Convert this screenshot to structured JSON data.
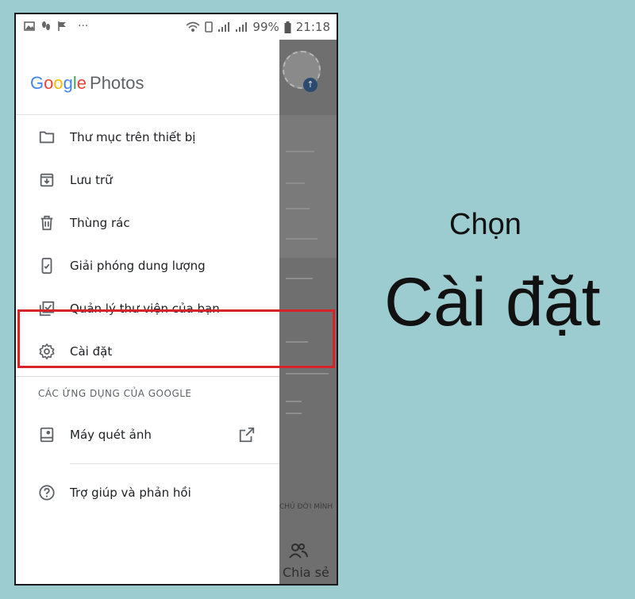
{
  "status_bar": {
    "battery": "99%",
    "time": "21:18",
    "more": "···"
  },
  "drawer": {
    "logo": {
      "letters": [
        "G",
        "o",
        "o",
        "g",
        "l",
        "e"
      ],
      "product": "Photos"
    },
    "menu": [
      {
        "label": "Thư mục trên thiết bị",
        "icon": "folder-icon"
      },
      {
        "label": "Lưu trữ",
        "icon": "archive-icon"
      },
      {
        "label": "Thùng rác",
        "icon": "trash-icon"
      },
      {
        "label": "Giải phóng dung lượng",
        "icon": "phone-check-icon"
      },
      {
        "label": "Quản lý thư viện của bạn",
        "icon": "library-check-icon"
      },
      {
        "label": "Cài đặt",
        "icon": "gear-icon"
      }
    ],
    "section_header": "CÁC ỨNG DỤNG CỦA GOOGLE",
    "apps": [
      {
        "label": "Máy quét ảnh",
        "icon": "photo-scanner-icon",
        "trailing_icon": "open-external-icon"
      }
    ],
    "help": {
      "label": "Trợ giúp và phản hồi",
      "icon": "help-icon"
    }
  },
  "background_app": {
    "bottom_tab": "Chia sẻ",
    "partial_text": "CHỦ ĐỜI MÌNH"
  },
  "caption": {
    "line1": "Chọn",
    "line2": "Cài đặt"
  },
  "colors": {
    "page_background": "#9ccbd0",
    "highlight": "#d8232a",
    "google_blue": "#4285f4",
    "google_red": "#ea4335",
    "google_yellow": "#fbbc05",
    "google_green": "#34a853"
  }
}
